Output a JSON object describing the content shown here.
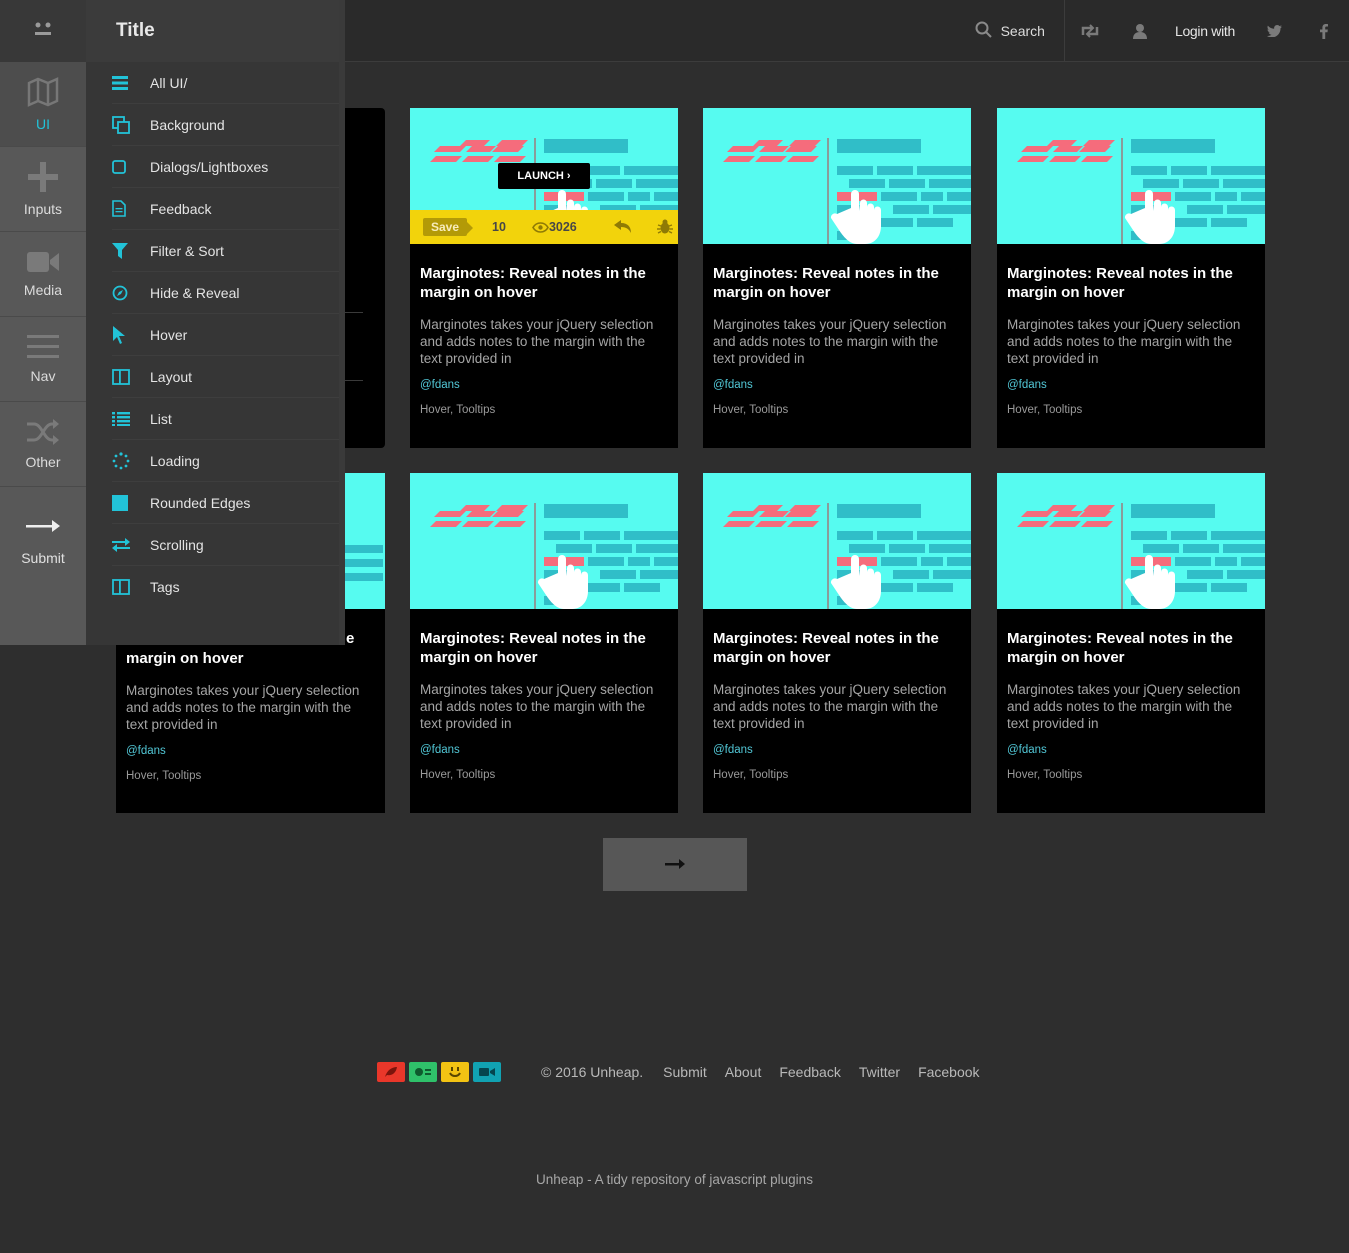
{
  "topbar": {
    "search_label": "Search",
    "login_label": "Login with"
  },
  "rail": {
    "items": [
      {
        "label": "UI",
        "icon": "map-icon"
      },
      {
        "label": "Inputs",
        "icon": "plus-icon"
      },
      {
        "label": "Media",
        "icon": "video-camera-icon"
      },
      {
        "label": "Nav",
        "icon": "menu-icon"
      },
      {
        "label": "Other",
        "icon": "shuffle-icon"
      }
    ],
    "submit_label": "Submit"
  },
  "flyout": {
    "title": "Title",
    "items": [
      {
        "label": "All UI/",
        "icon": "list-icon"
      },
      {
        "label": "Background",
        "icon": "copy-icon"
      },
      {
        "label": "Dialogs/Lightboxes",
        "icon": "square-icon"
      },
      {
        "label": "Feedback",
        "icon": "document-icon"
      },
      {
        "label": "Filter & Sort",
        "icon": "filter-icon"
      },
      {
        "label": "Hide & Reveal",
        "icon": "compass-icon"
      },
      {
        "label": "Hover",
        "icon": "cursor-icon"
      },
      {
        "label": "Layout",
        "icon": "layout-icon"
      },
      {
        "label": "List",
        "icon": "list-detail-icon"
      },
      {
        "label": "Loading",
        "icon": "spinner-icon"
      },
      {
        "label": "Rounded Edges",
        "icon": "filled-square-icon"
      },
      {
        "label": "Scrolling",
        "icon": "arrows-icon"
      },
      {
        "label": "Tags",
        "icon": "layout-icon"
      }
    ]
  },
  "cards": [
    {
      "title": "Marginotes: Reveal notes in the margin on hover",
      "desc": "Marginotes takes your jQuery selection and adds notes to the margin with the text provided in",
      "author": "@fdans",
      "tags": "Hover, Tooltips"
    },
    {
      "title": "Marginotes: Reveal notes in the margin on hover",
      "desc": "Marginotes takes your jQuery selection and adds notes to the margin with the text provided in",
      "author": "@fdans",
      "tags": "Hover, Tooltips"
    },
    {
      "title": "Marginotes: Reveal notes in the margin on hover",
      "desc": "Marginotes takes your jQuery selection and adds notes to the margin with the text provided in",
      "author": "@fdans",
      "tags": "Hover, Tooltips"
    },
    {
      "title": "Marginotes: Reveal notes in the margin on hover",
      "desc": "Marginotes takes your jQuery selection and adds notes to the margin with the text provided in",
      "author": "@fdans",
      "tags": "Hover, Tooltips"
    },
    {
      "title": "Marginotes: Reveal notes in the margin on hover",
      "desc": "Marginotes takes your jQuery selection and adds notes to the margin with the text provided in",
      "author": "@fdans",
      "tags": "Hover, Tooltips"
    },
    {
      "title": "Marginotes: Reveal notes in the margin on hover",
      "desc": "Marginotes takes your jQuery selection and adds notes to the margin with the text provided in",
      "author": "@fdans",
      "tags": "Hover, Tooltips"
    },
    {
      "title": "Marginotes: Reveal notes in the margin on hover",
      "desc": "Marginotes takes your jQuery selection and adds notes to the margin with the text provided in",
      "author": "@fdans",
      "tags": "Hover, Tooltips"
    }
  ],
  "partial_card": {
    "title_visible": "margin on hover",
    "desc": "Marginotes takes your jQuery selection and adds notes to the margin with the text provided in",
    "author": "@fdans",
    "tags": "Hover, Tooltips"
  },
  "hover_bar": {
    "save_label": "Save",
    "save_count": "10",
    "views": "3026",
    "launch_label": "LAUNCH ›"
  },
  "footer": {
    "copyright": "© 2016 Unheap.",
    "links": [
      "Submit",
      "About",
      "Feedback",
      "Twitter",
      "Facebook"
    ],
    "tagline": "Unheap - A tidy repository of javascript plugins"
  },
  "colors": {
    "accent": "#22c3d8",
    "thumb_bg": "#56fbf0",
    "hover_bar": "#f2d30c",
    "page_bg": "#2e2e2e"
  }
}
